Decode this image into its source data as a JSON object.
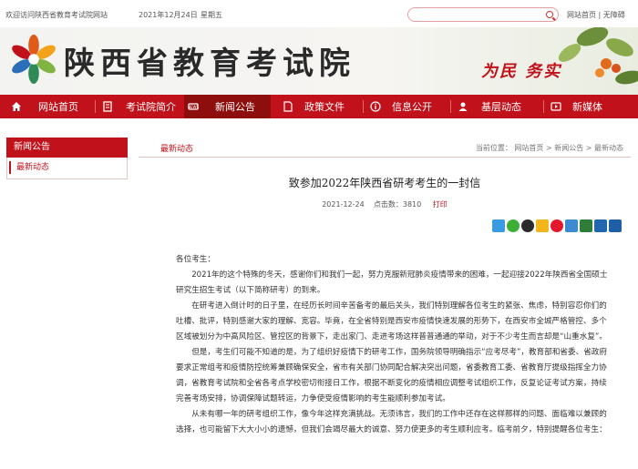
{
  "topbar": {
    "welcome": "欢迎访问陕西省教育考试院网站",
    "date": "2021年12月24日",
    "weekday": "星期五",
    "links": "网站首页 | 无障碍"
  },
  "banner": {
    "title": "陕西省教育考试院",
    "slogan": "为民  务实"
  },
  "nav": {
    "items": [
      {
        "label": "网站首页"
      },
      {
        "label": "考试院简介"
      },
      {
        "label": "新闻公告"
      },
      {
        "label": "政策文件"
      },
      {
        "label": "信息公开"
      },
      {
        "label": "基层动态"
      },
      {
        "label": "新媒体"
      }
    ]
  },
  "sidebar": {
    "heading": "新闻公告",
    "item": "最新动态"
  },
  "main": {
    "section": "最新动态",
    "breadcrumb": "当前位置：  网站首页  >  新闻公告  >  最新动态",
    "title": "致参加2022年陕西省研考考生的一封信",
    "date": "2021-12-24",
    "views": "点击数：3810",
    "print": "打印"
  },
  "article": {
    "greeting": "各位考生：",
    "paragraphs": [
      "2021年的这个特殊的冬天，感谢你们和我们一起，努力克服新冠肺炎疫情带来的困难，一起迎接2022年陕西省全国硕士研究生招生考试（以下简称研考）的到来。",
      "在研考进入倒计时的日子里，在经历长时间辛苦备考的最后关头，我们特别理解各位考生的紧张、焦虑，特别容忍你们的吐槽、批评，特别感谢大家的理解、宽容。毕竟，在全省特别是西安市疫情快速发展的形势下，在西安市全城严格管控、多个区域被划分为中高风险区、管控区的背景下，走出家门、走进考场这样普普通通的举动，对于不少考生而言却是“山重水复”。",
      "但是，考生们可能不知道的是，为了组织好疫情下的研考工作，国务院领导明确指示“应考尽考”，教育部和省委、省政府要求正常组考和疫情防控统筹兼顾确保安全，省市有关部门协同配合解决突出问题，省委教育工委、省教育厅提级指挥全力协调，省教育考试院和全省各考点学校密切衔接日工作，根据不断变化的疫情相应调整考试组织工作，反复论证考试方案，持续完善考场安排，协调保障试题转运，力争使受疫情影响的考生能顺利参加考试。",
      "从未有哪一年的研考组织工作，像今年这样充满挑战。无须讳言，我们的工作中还存在这样那样的问题、面临难以兼顾的选择，也可能留下大大小小的遗憾，但我们会竭尽最大的诚意、努力使更多的考生顺利应考。临考前夕，特别提醒各位考生："
    ]
  },
  "colors": {
    "brand_red": "#c1121b",
    "nav_active": "#8e0d0d"
  }
}
